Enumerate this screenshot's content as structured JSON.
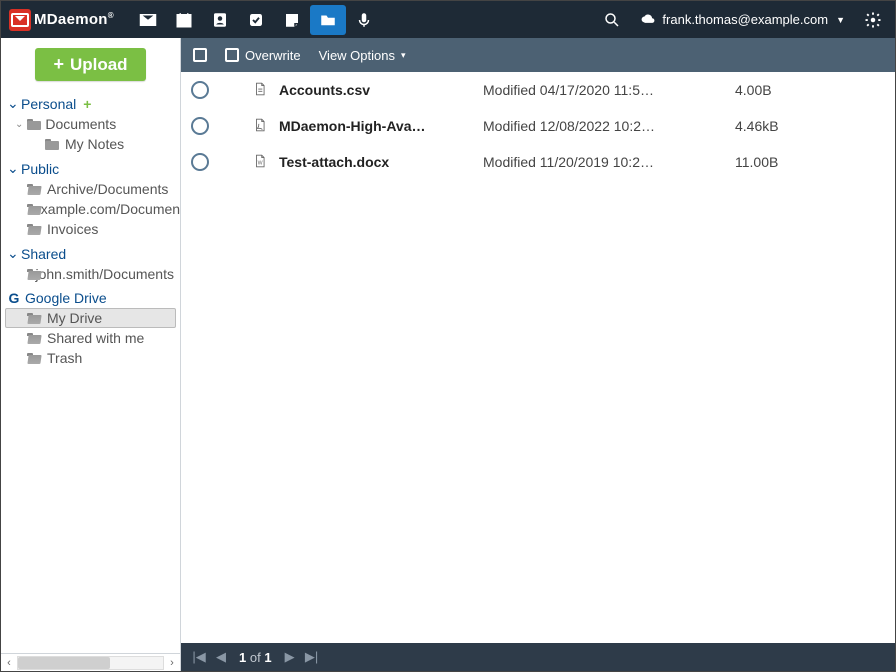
{
  "brand": {
    "name": "MDaemon",
    "reg": "®"
  },
  "user": {
    "email": "frank.thomas@example.com"
  },
  "sidebar": {
    "upload": "Upload",
    "sections": {
      "personal": {
        "label": "Personal",
        "items": [
          {
            "label": "Documents",
            "sub": [
              {
                "label": "My Notes"
              }
            ]
          }
        ]
      },
      "public": {
        "label": "Public",
        "items": [
          {
            "label": "Archive/Documents"
          },
          {
            "label": "example.com/Documents"
          },
          {
            "label": "Invoices"
          }
        ]
      },
      "shared": {
        "label": "Shared",
        "items": [
          {
            "label": "john.smith/Documents"
          }
        ]
      },
      "gdrive": {
        "label": "Google Drive",
        "items": [
          {
            "label": "My Drive",
            "selected": true
          },
          {
            "label": "Shared with me"
          },
          {
            "label": "Trash"
          }
        ]
      }
    }
  },
  "toolbar": {
    "overwrite": "Overwrite",
    "view_options": "View Options"
  },
  "files": [
    {
      "name": "Accounts.csv",
      "modified": "Modified 04/17/2020 11:5…",
      "size": "4.00B",
      "type": "generic"
    },
    {
      "name": "MDaemon-High-Ava…",
      "modified": "Modified 12/08/2022 10:2…",
      "size": "4.46kB",
      "type": "pdf"
    },
    {
      "name": "Test-attach.docx",
      "modified": "Modified 11/20/2019 10:2…",
      "size": "11.00B",
      "type": "word"
    }
  ],
  "pager": {
    "current": "1",
    "of": "of",
    "total": "1"
  }
}
